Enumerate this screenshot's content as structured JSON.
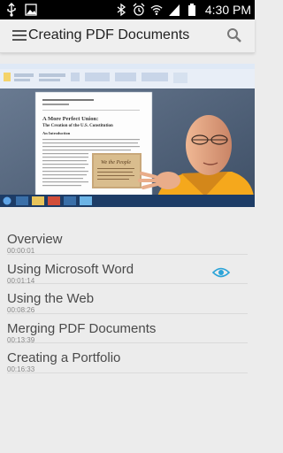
{
  "status": {
    "time": "4:30 PM"
  },
  "header": {
    "title": "Creating PDF Documents"
  },
  "video": {
    "doc_heading_1": "A More Perfect Union:",
    "doc_heading_2": "The Creation of the U.S. Constitution",
    "doc_subheading": "An Introduction",
    "image_caption": "We the People"
  },
  "chapters": [
    {
      "title": "Overview",
      "time": "00:00:01"
    },
    {
      "title": "Using Microsoft Word",
      "time": "00:01:14",
      "active": true
    },
    {
      "title": "Using the Web",
      "time": "00:08:26"
    },
    {
      "title": "Merging PDF Documents",
      "time": "00:13:39"
    },
    {
      "title": "Creating a Portfolio",
      "time": "00:16:33"
    }
  ],
  "colors": {
    "accent": "#2ca4d8",
    "app_bar": "#efefef",
    "status_bar": "#000000"
  }
}
